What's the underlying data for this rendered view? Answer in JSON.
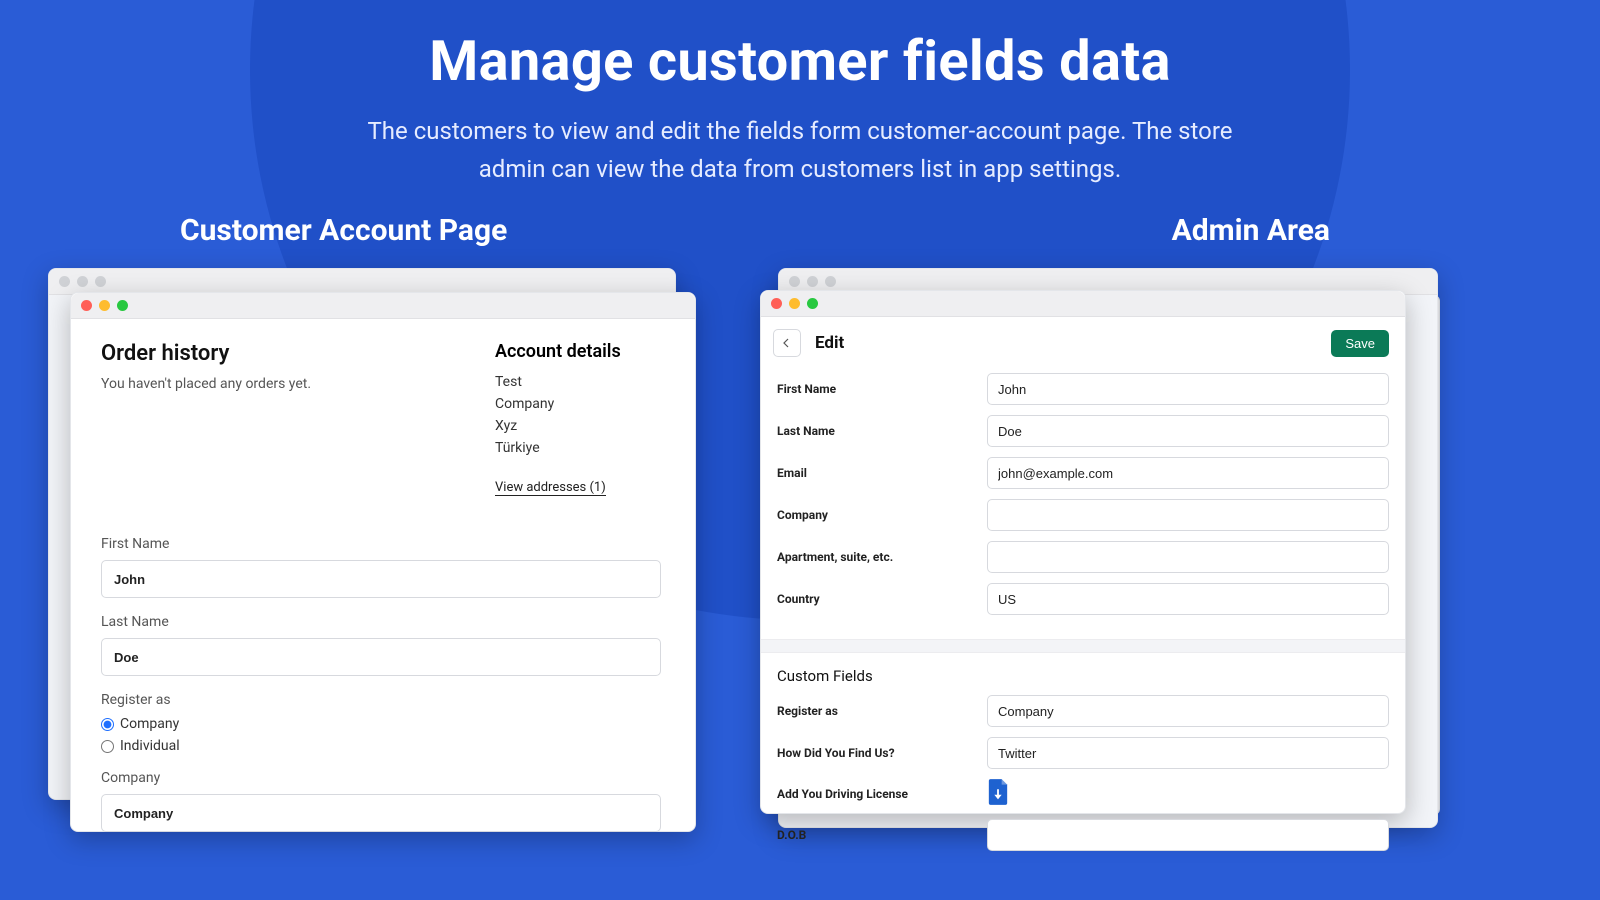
{
  "hero": {
    "title": "Manage customer fields data",
    "subtitle": "The customers to view and edit the fields form customer-account page. The store admin can view the data from customers list in app settings."
  },
  "sections": {
    "left_title": "Customer Account Page",
    "right_title": "Admin Area"
  },
  "customer": {
    "order_history_title": "Order history",
    "order_history_empty": "You haven't placed any orders yet.",
    "account_details_title": "Account details",
    "account_lines": {
      "name": "Test",
      "company": "Company",
      "street": "Xyz",
      "country": "Türkiye"
    },
    "view_addresses": "View addresses (1)",
    "labels": {
      "first_name": "First Name",
      "last_name": "Last Name",
      "register_as": "Register as",
      "company": "Company"
    },
    "values": {
      "first_name": "John",
      "last_name": "Doe",
      "company": "Company"
    },
    "register_options": {
      "company": "Company",
      "individual": "Individual"
    }
  },
  "admin": {
    "edit_title": "Edit",
    "save_label": "Save",
    "fields": {
      "first_name": {
        "label": "First Name",
        "value": "John"
      },
      "last_name": {
        "label": "Last Name",
        "value": "Doe"
      },
      "email": {
        "label": "Email",
        "value": "john@example.com"
      },
      "company": {
        "label": "Company",
        "value": ""
      },
      "apartment": {
        "label": "Apartment, suite, etc.",
        "value": ""
      },
      "country": {
        "label": "Country",
        "value": "US"
      }
    },
    "custom_fields_title": "Custom Fields",
    "custom": {
      "register_as": {
        "label": "Register as",
        "value": "Company"
      },
      "how_find": {
        "label": "How Did You Find Us?",
        "value": "Twitter"
      },
      "driving_license": {
        "label": "Add You Driving License"
      },
      "dob": {
        "label": "D.O.B",
        "value": ""
      }
    }
  }
}
